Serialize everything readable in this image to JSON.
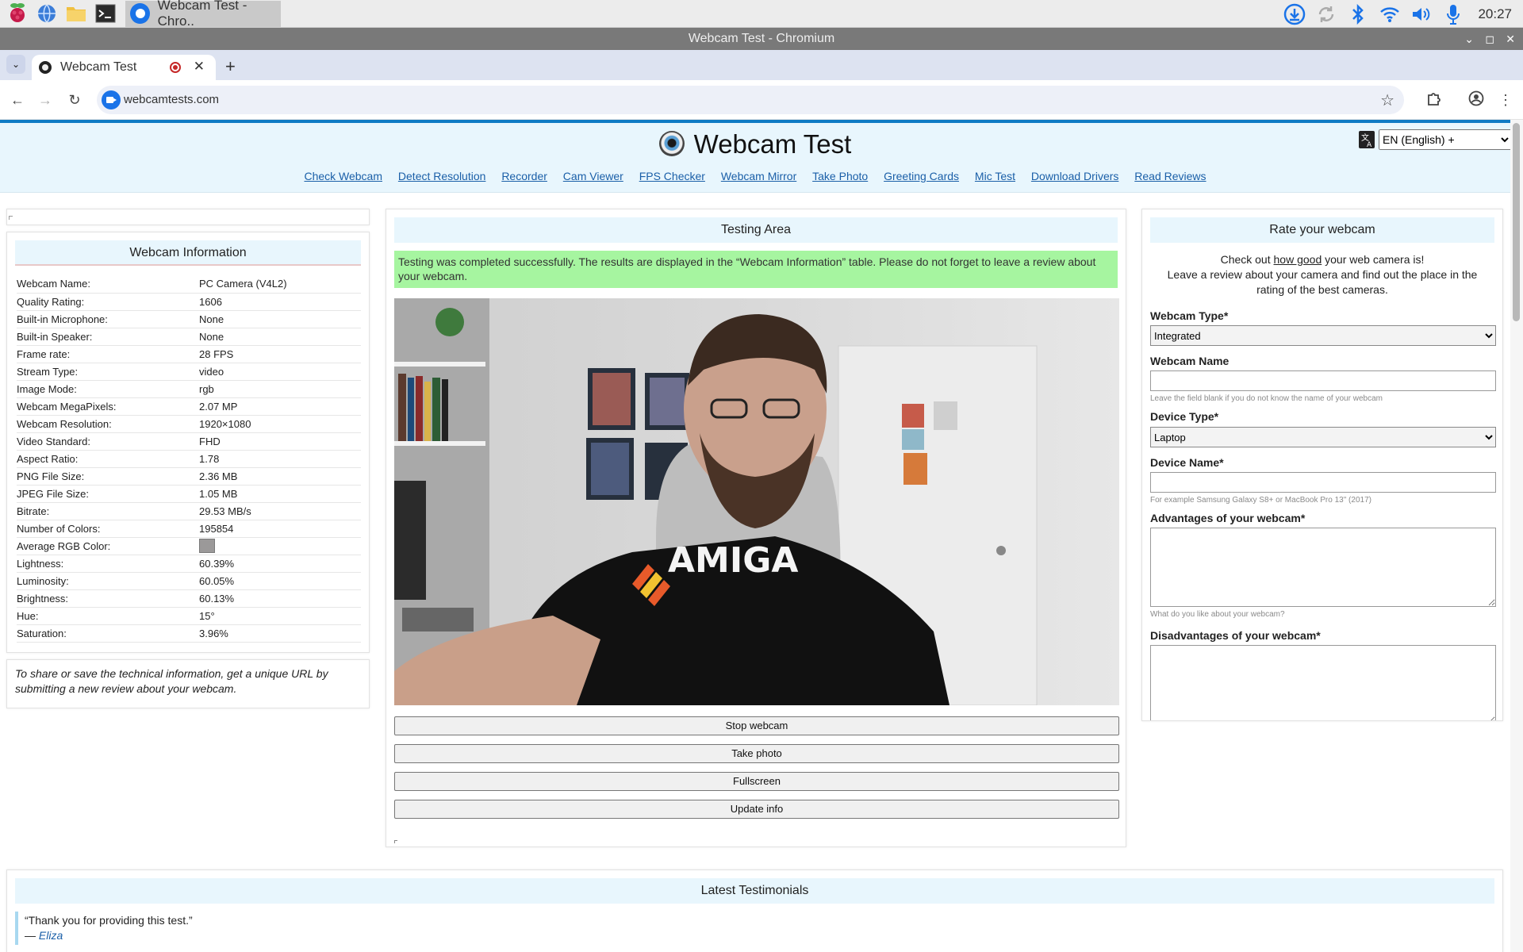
{
  "taskbar": {
    "window_task_label": "Webcam Test - Chro..",
    "clock": "20:27"
  },
  "window": {
    "title": "Webcam Test - Chromium"
  },
  "browser": {
    "tab_title": "Webcam Test",
    "url": "webcamtests.com"
  },
  "site": {
    "title": "Webcam Test",
    "language": "EN (English) +",
    "nav": [
      "Check Webcam",
      "Detect Resolution",
      "Recorder",
      "Cam Viewer",
      "FPS Checker",
      "Webcam Mirror",
      "Take Photo",
      "Greeting Cards",
      "Mic Test",
      "Download Drivers",
      "Read Reviews"
    ]
  },
  "info": {
    "title": "Webcam Information",
    "rows": [
      {
        "label": "Webcam Name:",
        "value": "PC Camera (V4L2)"
      },
      {
        "label": "Quality Rating:",
        "value": "1606"
      },
      {
        "label": "Built-in Microphone:",
        "value": "None"
      },
      {
        "label": "Built-in Speaker:",
        "value": "None"
      },
      {
        "label": "Frame rate:",
        "value": "28 FPS"
      },
      {
        "label": "Stream Type:",
        "value": "video"
      },
      {
        "label": "Image Mode:",
        "value": "rgb"
      },
      {
        "label": "Webcam MegaPixels:",
        "value": "2.07 MP"
      },
      {
        "label": "Webcam Resolution:",
        "value": "1920×1080"
      },
      {
        "label": "Video Standard:",
        "value": "FHD"
      },
      {
        "label": "Aspect Ratio:",
        "value": "1.78"
      },
      {
        "label": "PNG File Size:",
        "value": "2.36 MB"
      },
      {
        "label": "JPEG File Size:",
        "value": "1.05 MB"
      },
      {
        "label": "Bitrate:",
        "value": "29.53 MB/s"
      },
      {
        "label": "Number of Colors:",
        "value": "195854"
      },
      {
        "label": "Average RGB Color:",
        "value": ""
      },
      {
        "label": "Lightness:",
        "value": "60.39%"
      },
      {
        "label": "Luminosity:",
        "value": "60.05%"
      },
      {
        "label": "Brightness:",
        "value": "60.13%"
      },
      {
        "label": "Hue:",
        "value": "15°"
      },
      {
        "label": "Saturation:",
        "value": "3.96%"
      }
    ],
    "average_color": "#9b9999",
    "share_note": "To share or save the technical information, get a unique URL by submitting a new review about your webcam."
  },
  "testing": {
    "title": "Testing Area",
    "success_message": "Testing was completed successfully. The results are displayed in the “Webcam Information” table. Please do not forget to leave a review about your webcam.",
    "video_shirt_text": "AMIGA",
    "buttons": [
      "Stop webcam",
      "Take photo",
      "Fullscreen",
      "Update info"
    ]
  },
  "rate": {
    "title": "Rate your webcam",
    "intro_pre": "Check out ",
    "intro_link": "how good",
    "intro_post": " your web camera is!",
    "intro_line2": "Leave a review about your camera and find out the place in the rating of the best cameras.",
    "webcam_type_label": "Webcam Type*",
    "webcam_type_value": "Integrated",
    "webcam_name_label": "Webcam Name",
    "webcam_name_hint": "Leave the field blank if you do not know the name of your webcam",
    "device_type_label": "Device Type*",
    "device_type_value": "Laptop",
    "device_name_label": "Device Name*",
    "device_name_hint": "For example Samsung Galaxy S8+ or MacBook Pro 13\" (2017)",
    "advantages_label": "Advantages of your webcam*",
    "advantages_hint": "What do you like about your webcam?",
    "disadvantages_label": "Disadvantages of your webcam*"
  },
  "testimonials": {
    "title": "Latest Testimonials",
    "quote": "“Thank you for providing this test.”",
    "dash": "— ",
    "author": "Eliza"
  }
}
